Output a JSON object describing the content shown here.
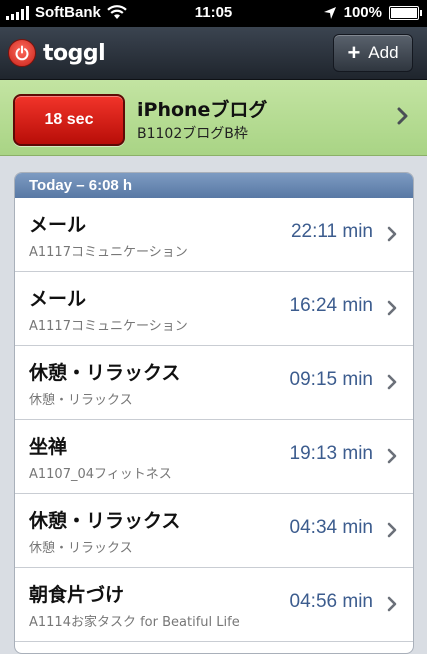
{
  "status_bar": {
    "carrier": "SoftBank",
    "time": "11:05",
    "battery": "100%"
  },
  "nav": {
    "app_name": "toggl",
    "add_label": "Add"
  },
  "running": {
    "timer": "18 sec",
    "title": "iPhoneブログ",
    "project": "B1102ブログB枠"
  },
  "list": {
    "header": "Today – 6:08 h",
    "entries": [
      {
        "title": "メール",
        "project": "A1117コミュニケーション",
        "duration": "22:11 min"
      },
      {
        "title": "メール",
        "project": "A1117コミュニケーション",
        "duration": "16:24 min"
      },
      {
        "title": "休憩・リラックス",
        "project": "休憩・リラックス",
        "duration": "09:15 min"
      },
      {
        "title": "坐禅",
        "project": "A1107_04フィットネス",
        "duration": "19:13 min"
      },
      {
        "title": "休憩・リラックス",
        "project": "休憩・リラックス",
        "duration": "04:34 min"
      },
      {
        "title": "朝食片づけ",
        "project": "A1114お家タスク for Beatiful Life",
        "duration": "04:56 min"
      }
    ]
  },
  "colors": {
    "accent_red": "#d81e16",
    "running_green": "#b6dc93",
    "header_blue": "#6a88b3",
    "duration_blue": "#3c5c8e"
  }
}
